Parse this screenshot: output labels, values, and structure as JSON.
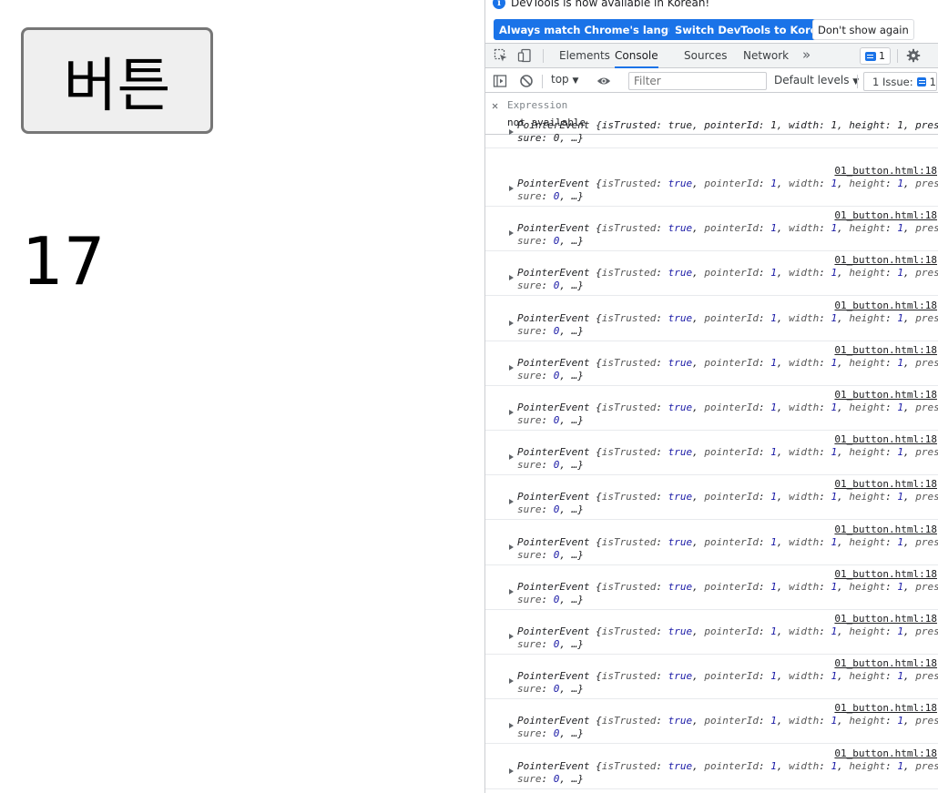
{
  "page": {
    "button_label": "버튼",
    "counter_value": "17"
  },
  "devtools": {
    "infobar": {
      "message": "DevTools is now available in Korean!",
      "btn_match": "Always match Chrome's language",
      "btn_switch": "Switch DevTools to Korean",
      "btn_dismiss": "Don't show again"
    },
    "tabs": [
      "Elements",
      "Console",
      "Sources",
      "Network"
    ],
    "active_tab": "Console",
    "message_count": "1",
    "toolbar": {
      "context": "top",
      "filter_placeholder": "Filter",
      "levels": "Default levels",
      "issues": "1 Issue:",
      "issues_count": "1"
    },
    "live_expression": {
      "label": "Expression",
      "value": "not available"
    },
    "log": {
      "first_line1": "PointerEvent {isTrusted: true, pointerId: 1, width: 1, height: 1, pres",
      "first_line2": "sure: 0, …}",
      "source": "01_button.html:18",
      "entries": [
        {
          "type": "PointerEvent",
          "isTrusted": "true",
          "pointerId": "1",
          "width": "1",
          "height": "1",
          "pressure": "0"
        },
        {
          "type": "PointerEvent",
          "isTrusted": "true",
          "pointerId": "1",
          "width": "1",
          "height": "1",
          "pressure": "0"
        },
        {
          "type": "PointerEvent",
          "isTrusted": "true",
          "pointerId": "1",
          "width": "1",
          "height": "1",
          "pressure": "0"
        },
        {
          "type": "PointerEvent",
          "isTrusted": "true",
          "pointerId": "1",
          "width": "1",
          "height": "1",
          "pressure": "0"
        },
        {
          "type": "PointerEvent",
          "isTrusted": "true",
          "pointerId": "1",
          "width": "1",
          "height": "1",
          "pressure": "0"
        },
        {
          "type": "PointerEvent",
          "isTrusted": "true",
          "pointerId": "1",
          "width": "1",
          "height": "1",
          "pressure": "0"
        },
        {
          "type": "PointerEvent",
          "isTrusted": "true",
          "pointerId": "1",
          "width": "1",
          "height": "1",
          "pressure": "0"
        },
        {
          "type": "PointerEvent",
          "isTrusted": "true",
          "pointerId": "1",
          "width": "1",
          "height": "1",
          "pressure": "0"
        },
        {
          "type": "PointerEvent",
          "isTrusted": "true",
          "pointerId": "1",
          "width": "1",
          "height": "1",
          "pressure": "0"
        },
        {
          "type": "PointerEvent",
          "isTrusted": "true",
          "pointerId": "1",
          "width": "1",
          "height": "1",
          "pressure": "0"
        },
        {
          "type": "PointerEvent",
          "isTrusted": "true",
          "pointerId": "1",
          "width": "1",
          "height": "1",
          "pressure": "0"
        },
        {
          "type": "PointerEvent",
          "isTrusted": "true",
          "pointerId": "1",
          "width": "1",
          "height": "1",
          "pressure": "0"
        },
        {
          "type": "PointerEvent",
          "isTrusted": "true",
          "pointerId": "1",
          "width": "1",
          "height": "1",
          "pressure": "0"
        },
        {
          "type": "PointerEvent",
          "isTrusted": "true",
          "pointerId": "1",
          "width": "1",
          "height": "1",
          "pressure": "0"
        }
      ]
    },
    "icons": {
      "info": "info-icon",
      "inspect": "inspect-element-icon",
      "device": "device-toolbar-icon",
      "settings": "gear-icon",
      "sidebar": "console-sidebar-icon",
      "clear": "clear-console-icon",
      "eye": "eye-icon"
    },
    "accent_color": "#1a73e8"
  }
}
